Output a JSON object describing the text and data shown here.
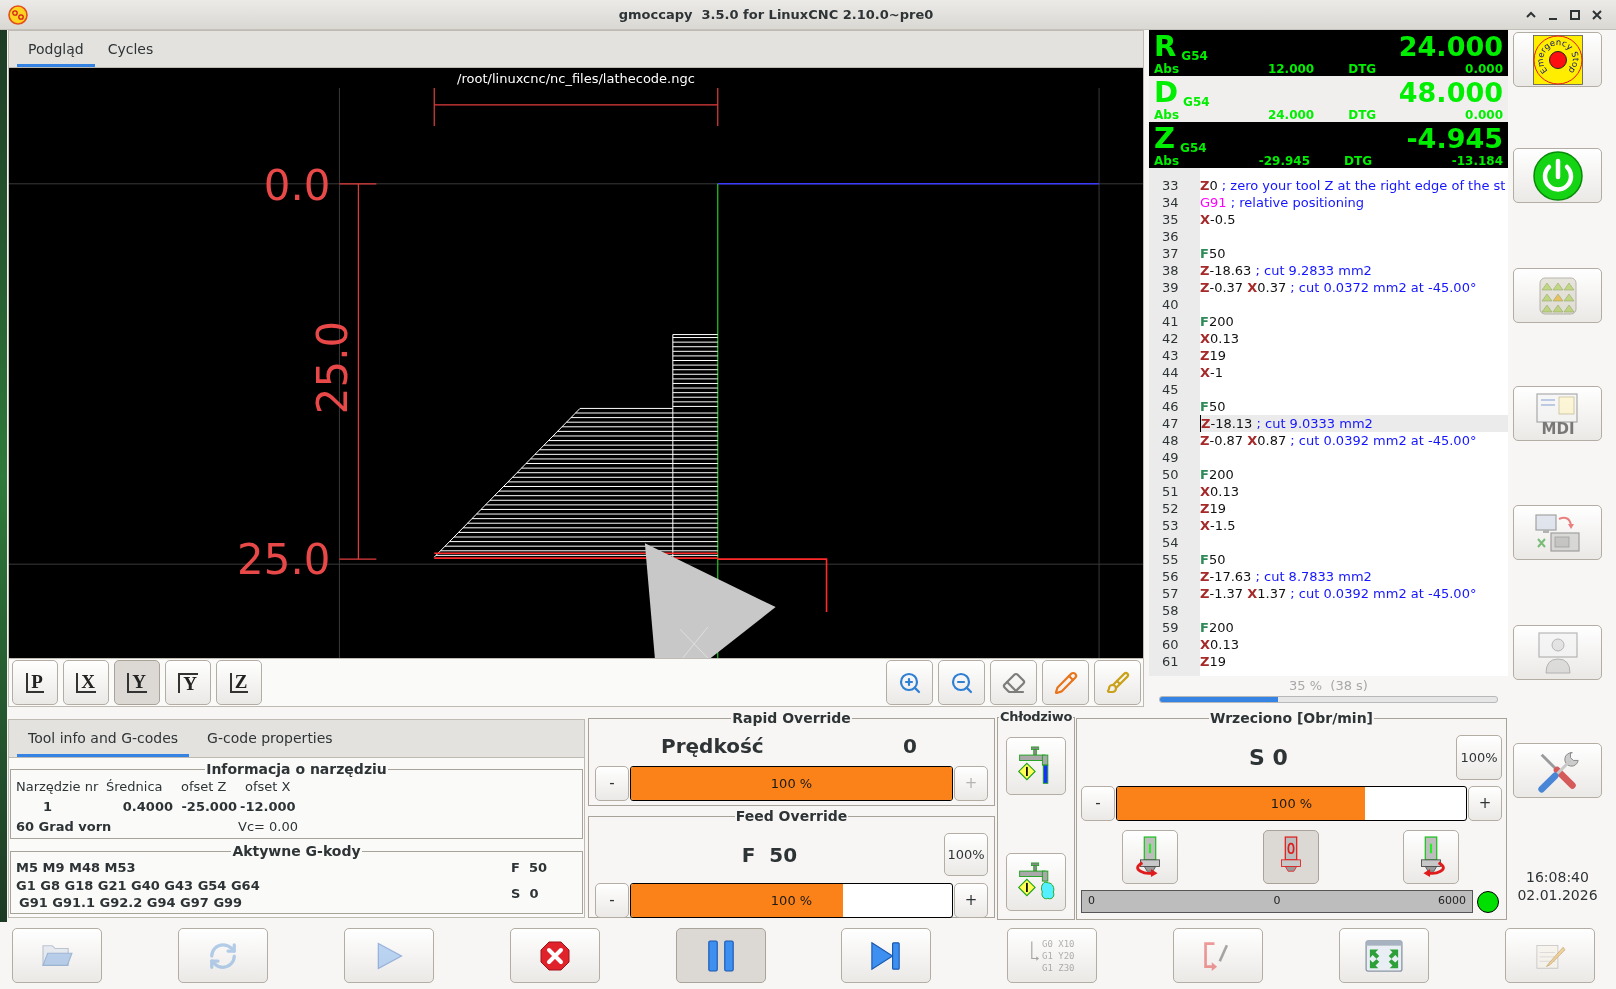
{
  "window": {
    "title": "gmoccapy  3.5.0 for LinuxCNC 2.10.0~pre0"
  },
  "main_tabs": [
    {
      "label": "Podgląd",
      "selected": true
    },
    {
      "label": "Cycles",
      "selected": false
    }
  ],
  "preview": {
    "file_name": "/root/linuxcnc/nc_files/lathecode.ngc",
    "dimension_labels": [
      "0.0",
      "25.0",
      "25.0"
    ]
  },
  "view_buttons": [
    {
      "label": "P",
      "kind": "bottom",
      "selected": false
    },
    {
      "label": "X",
      "kind": "bottom",
      "selected": false
    },
    {
      "label": "Y",
      "kind": "bottom",
      "selected": true
    },
    {
      "label": "Y",
      "kind": "top",
      "selected": false
    },
    {
      "label": "Z",
      "kind": "bottom",
      "selected": false
    }
  ],
  "dro": [
    {
      "axis": "R",
      "system": "G54",
      "value": "24.000",
      "abs_label": "Abs",
      "abs": "12.000",
      "dtg_label": "DTG",
      "dtg": "0.000",
      "selected": false
    },
    {
      "axis": "D",
      "system": "G54",
      "value": "48.000",
      "abs_label": "Abs",
      "abs": "24.000",
      "dtg_label": "DTG",
      "dtg": "0.000",
      "selected": true
    },
    {
      "axis": "Z",
      "system": "G54",
      "value": "-4.945",
      "abs_label": "Abs",
      "abs": "-29.945",
      "dtg_label": "DTG",
      "dtg": "-13.184",
      "selected": false
    }
  ],
  "gcode": {
    "lines": [
      {
        "number": "33",
        "current": false,
        "tokens": [
          {
            "kind": "axis",
            "text": "Z"
          },
          {
            "kind": "number",
            "text": "0 "
          },
          {
            "kind": "comment",
            "text": "; zero your tool Z at the right edge of the st"
          }
        ]
      },
      {
        "number": "34",
        "current": false,
        "tokens": [
          {
            "kind": "gcode",
            "text": "G91 "
          },
          {
            "kind": "comment",
            "text": "; relative positioning"
          }
        ]
      },
      {
        "number": "35",
        "current": false,
        "tokens": [
          {
            "kind": "axis",
            "text": "X"
          },
          {
            "kind": "number",
            "text": "-0.5"
          }
        ]
      },
      {
        "number": "36",
        "current": false
      },
      {
        "number": "37",
        "current": false,
        "tokens": [
          {
            "kind": "feed",
            "text": "F"
          },
          {
            "kind": "number",
            "text": "50"
          }
        ]
      },
      {
        "number": "38",
        "current": false,
        "tokens": [
          {
            "kind": "axis",
            "text": "Z"
          },
          {
            "kind": "number",
            "text": "-18.63 "
          },
          {
            "kind": "comment",
            "text": "; cut 9.2833 mm2"
          }
        ]
      },
      {
        "number": "39",
        "current": false,
        "tokens": [
          {
            "kind": "axis",
            "text": "Z"
          },
          {
            "kind": "number",
            "text": "-0.37 "
          },
          {
            "kind": "axis",
            "text": "X"
          },
          {
            "kind": "number",
            "text": "0.37 "
          },
          {
            "kind": "comment",
            "text": "; cut 0.0372 mm2 at -45.00°"
          }
        ]
      },
      {
        "number": "40",
        "current": false
      },
      {
        "number": "41",
        "current": false,
        "tokens": [
          {
            "kind": "feed",
            "text": "F"
          },
          {
            "kind": "number",
            "text": "200"
          }
        ]
      },
      {
        "number": "42",
        "current": false,
        "tokens": [
          {
            "kind": "axis",
            "text": "X"
          },
          {
            "kind": "number",
            "text": "0.13"
          }
        ]
      },
      {
        "number": "43",
        "current": false,
        "tokens": [
          {
            "kind": "axis",
            "text": "Z"
          },
          {
            "kind": "number",
            "text": "19"
          }
        ]
      },
      {
        "number": "44",
        "current": false,
        "tokens": [
          {
            "kind": "axis",
            "text": "X"
          },
          {
            "kind": "number",
            "text": "-1"
          }
        ]
      },
      {
        "number": "45",
        "current": false
      },
      {
        "number": "46",
        "current": false,
        "tokens": [
          {
            "kind": "feed",
            "text": "F"
          },
          {
            "kind": "number",
            "text": "50"
          }
        ]
      },
      {
        "number": "47",
        "current": true,
        "tokens": [
          {
            "kind": "axis",
            "text": "Z"
          },
          {
            "kind": "number",
            "text": "-18.13 "
          },
          {
            "kind": "comment",
            "text": "; cut 9.0333 mm2"
          }
        ]
      },
      {
        "number": "48",
        "current": false,
        "tokens": [
          {
            "kind": "axis",
            "text": "Z"
          },
          {
            "kind": "number",
            "text": "-0.87 "
          },
          {
            "kind": "axis",
            "text": "X"
          },
          {
            "kind": "number",
            "text": "0.87 "
          },
          {
            "kind": "comment",
            "text": "; cut 0.0392 mm2 at -45.00°"
          }
        ]
      },
      {
        "number": "49",
        "current": false
      },
      {
        "number": "50",
        "current": false,
        "tokens": [
          {
            "kind": "feed",
            "text": "F"
          },
          {
            "kind": "number",
            "text": "200"
          }
        ]
      },
      {
        "number": "51",
        "current": false,
        "tokens": [
          {
            "kind": "axis",
            "text": "X"
          },
          {
            "kind": "number",
            "text": "0.13"
          }
        ]
      },
      {
        "number": "52",
        "current": false,
        "tokens": [
          {
            "kind": "axis",
            "text": "Z"
          },
          {
            "kind": "number",
            "text": "19"
          }
        ]
      },
      {
        "number": "53",
        "current": false,
        "tokens": [
          {
            "kind": "axis",
            "text": "X"
          },
          {
            "kind": "number",
            "text": "-1.5"
          }
        ]
      },
      {
        "number": "54",
        "current": false
      },
      {
        "number": "55",
        "current": false,
        "tokens": [
          {
            "kind": "feed",
            "text": "F"
          },
          {
            "kind": "number",
            "text": "50"
          }
        ]
      },
      {
        "number": "56",
        "current": false,
        "tokens": [
          {
            "kind": "axis",
            "text": "Z"
          },
          {
            "kind": "number",
            "text": "-17.63 "
          },
          {
            "kind": "comment",
            "text": "; cut 8.7833 mm2"
          }
        ]
      },
      {
        "number": "57",
        "current": false,
        "tokens": [
          {
            "kind": "axis",
            "text": "Z"
          },
          {
            "kind": "number",
            "text": "-1.37 "
          },
          {
            "kind": "axis",
            "text": "X"
          },
          {
            "kind": "number",
            "text": "1.37 "
          },
          {
            "kind": "comment",
            "text": "; cut 0.0392 mm2 at -45.00°"
          }
        ]
      },
      {
        "number": "58",
        "current": false
      },
      {
        "number": "59",
        "current": false,
        "tokens": [
          {
            "kind": "feed",
            "text": "F"
          },
          {
            "kind": "number",
            "text": "200"
          }
        ]
      },
      {
        "number": "60",
        "current": false,
        "tokens": [
          {
            "kind": "axis",
            "text": "X"
          },
          {
            "kind": "number",
            "text": "0.13"
          }
        ]
      },
      {
        "number": "61",
        "current": false,
        "tokens": [
          {
            "kind": "axis",
            "text": "Z"
          },
          {
            "kind": "number",
            "text": "19"
          }
        ]
      }
    ]
  },
  "progress": {
    "text": "35 %  (38 s)",
    "level": 0.35
  },
  "info_tabs": [
    {
      "label": "Tool info and G-codes",
      "selected": true
    },
    {
      "label": "G-code properties",
      "selected": false
    }
  ],
  "tool_info": {
    "title": "Informacja o narzędziu",
    "headers": [
      "Narzędzie nr",
      "Średnica",
      "ofset Z",
      "ofset X"
    ],
    "values": [
      "1",
      "0.4000",
      "-25.000",
      "-12.000"
    ],
    "description": "60 Grad vorn",
    "cutting_speed": "Vc= 0.00"
  },
  "active_gcodes": {
    "title": "Aktywne G-kody",
    "lines": [
      "M5 M9 M48 M53",
      "G1 G8 G18 G21 G40 G43 G54 G64",
      "G91 G91.1 G92.2 G94 G97 G99"
    ],
    "feed": "F  50",
    "speed": "S  0"
  },
  "rapid_override": {
    "title": "Rapid Override",
    "label": "Prędkość",
    "value": "0",
    "decrease": {
      "label": "-",
      "disabled": false
    },
    "increase": {
      "label": "+",
      "disabled": true
    },
    "bar": {
      "text": "100 %",
      "level": 1.0
    }
  },
  "feed_override": {
    "title": "Feed Override",
    "value": "F  50",
    "reset": "100%",
    "decrease": {
      "label": "-",
      "disabled": false
    },
    "increase": {
      "label": "+",
      "disabled": false
    },
    "bar": {
      "text": "100 %",
      "level": 0.66
    }
  },
  "coolant": {
    "title": "Chłodziwo",
    "buttons": [
      {
        "kind": "flood"
      },
      {
        "kind": "mist"
      }
    ]
  },
  "spindle": {
    "title": "Wrzeciono [Obr/min]",
    "value": "S 0",
    "reset": "100%",
    "decrease": {
      "label": "-",
      "disabled": false
    },
    "increase": {
      "label": "+",
      "disabled": false
    },
    "bar": {
      "text": "100 %",
      "level": 0.71
    },
    "direction_buttons": [
      {
        "kind": "ccw",
        "selected": false
      },
      {
        "kind": "stop",
        "selected": true
      },
      {
        "kind": "cw",
        "selected": false
      }
    ],
    "speed_gauge": {
      "min": "0",
      "value": "0",
      "max": "6000"
    },
    "at_speed": true
  },
  "side_buttons": [
    {
      "kind": "estop",
      "label": "Emergency Stop",
      "disabled": false
    },
    {
      "kind": "power",
      "on": true,
      "disabled": false
    },
    {
      "kind": "manual",
      "disabled": true
    },
    {
      "kind": "mdi",
      "label": "MDI",
      "disabled": true
    },
    {
      "kind": "auto",
      "disabled": true
    },
    {
      "kind": "user",
      "disabled": true
    },
    {
      "kind": "settings",
      "disabled": false
    }
  ],
  "clock": {
    "time": "16:08:40",
    "date": "02.01.2026"
  },
  "bottom_buttons": [
    {
      "kind": "open",
      "disabled": true,
      "selected": false
    },
    {
      "kind": "reload",
      "disabled": true,
      "selected": false
    },
    {
      "kind": "run",
      "disabled": true,
      "selected": false
    },
    {
      "kind": "stop",
      "disabled": false,
      "selected": false
    },
    {
      "kind": "pause",
      "disabled": false,
      "selected": true
    },
    {
      "kind": "step",
      "disabled": false,
      "selected": false
    },
    {
      "kind": "run_from_line",
      "disabled": true,
      "selected": false,
      "code_lines": [
        "G0 X10",
        "G1 Y20",
        "G1 Z30"
      ]
    },
    {
      "kind": "block_delete",
      "disabled": true,
      "selected": false
    },
    {
      "kind": "fullscreen",
      "disabled": false,
      "selected": false
    },
    {
      "kind": "edit",
      "disabled": true,
      "selected": false
    }
  ]
}
